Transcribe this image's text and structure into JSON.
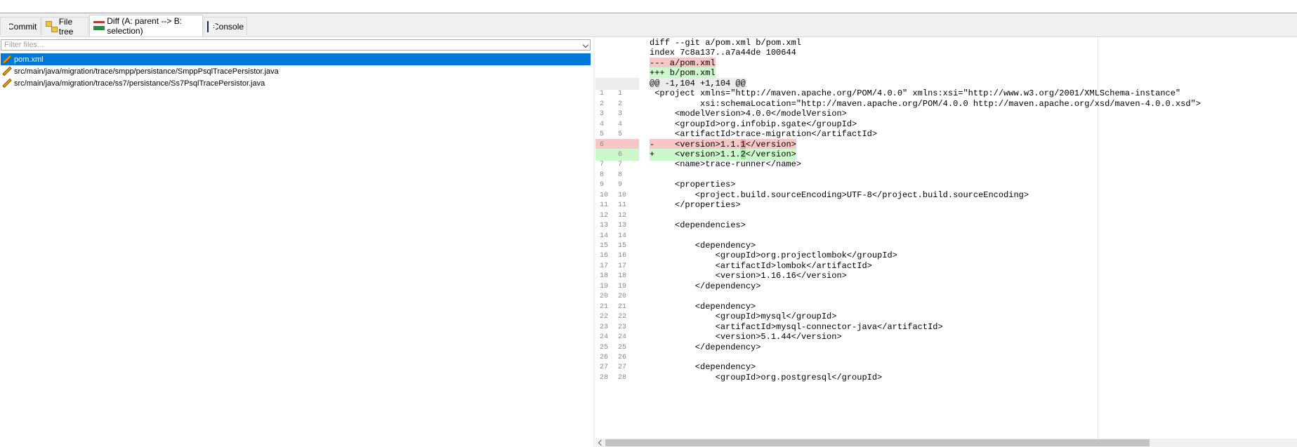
{
  "tabs": [
    {
      "label": "Commit",
      "icon": "info-icon"
    },
    {
      "label": "File tree",
      "icon": "file-tree-icon"
    },
    {
      "label": "Diff (A: parent --> B: selection)",
      "icon": "diff-icon"
    },
    {
      "label": "Console",
      "icon": "console-icon"
    }
  ],
  "filter": {
    "placeholder": "Filter files..."
  },
  "files": [
    {
      "name": "pom.xml",
      "status_icon": "modified-pencil-icon",
      "selected": true
    },
    {
      "name": "src/main/java/migration/trace/smpp/persistance/SmppPsqlTracePersistor.java",
      "status_icon": "modified-pencil-icon",
      "selected": false
    },
    {
      "name": "src/main/java/migration/trace/ss7/persistance/Ss7PsqlTracePersistor.java",
      "status_icon": "modified-pencil-icon",
      "selected": false
    }
  ],
  "diff": {
    "header": [
      {
        "text": "diff --git a/pom.xml b/pom.xml",
        "kind": "plain"
      },
      {
        "text": "index 7c8a137..a7a44de 100644",
        "kind": "plain"
      },
      {
        "text": "--- a/pom.xml",
        "kind": "del"
      },
      {
        "text": "+++ b/pom.xml",
        "kind": "add"
      },
      {
        "text": "@@ -1,104 +1,104 @@",
        "kind": "hunk"
      }
    ],
    "lines": [
      {
        "a": "1",
        "b": "1",
        "kind": "ctx",
        "text": " <project xmlns=\"http://maven.apache.org/POM/4.0.0\" xmlns:xsi=\"http://www.w3.org/2001/XMLSchema-instance\""
      },
      {
        "a": "2",
        "b": "2",
        "kind": "ctx",
        "text": "          xsi:schemaLocation=\"http://maven.apache.org/POM/4.0.0 http://maven.apache.org/xsd/maven-4.0.0.xsd\">"
      },
      {
        "a": "3",
        "b": "3",
        "kind": "ctx",
        "text": "     <modelVersion>4.0.0</modelVersion>"
      },
      {
        "a": "4",
        "b": "4",
        "kind": "ctx",
        "text": "     <groupId>org.infobip.sgate</groupId>"
      },
      {
        "a": "5",
        "b": "5",
        "kind": "ctx",
        "text": "     <artifactId>trace-migration</artifactId>"
      },
      {
        "a": "6",
        "b": "",
        "kind": "del",
        "text": "-    <version>1.1.1</version>",
        "pre": "-    <version>1.1.",
        "mark": "1",
        "post": "</version>"
      },
      {
        "a": "",
        "b": "6",
        "kind": "add",
        "text": "+    <version>1.1.2</version>",
        "pre": "+    <version>1.1.",
        "mark": "2",
        "post": "</version>"
      },
      {
        "a": "7",
        "b": "7",
        "kind": "ctx",
        "text": "     <name>trace-runner</name>"
      },
      {
        "a": "8",
        "b": "8",
        "kind": "ctx",
        "text": ""
      },
      {
        "a": "9",
        "b": "9",
        "kind": "ctx",
        "text": "     <properties>"
      },
      {
        "a": "10",
        "b": "10",
        "kind": "ctx",
        "text": "         <project.build.sourceEncoding>UTF-8</project.build.sourceEncoding>"
      },
      {
        "a": "11",
        "b": "11",
        "kind": "ctx",
        "text": "     </properties>"
      },
      {
        "a": "12",
        "b": "12",
        "kind": "ctx",
        "text": ""
      },
      {
        "a": "13",
        "b": "13",
        "kind": "ctx",
        "text": "     <dependencies>"
      },
      {
        "a": "14",
        "b": "14",
        "kind": "ctx",
        "text": ""
      },
      {
        "a": "15",
        "b": "15",
        "kind": "ctx",
        "text": "         <dependency>"
      },
      {
        "a": "16",
        "b": "16",
        "kind": "ctx",
        "text": "             <groupId>org.projectlombok</groupId>"
      },
      {
        "a": "17",
        "b": "17",
        "kind": "ctx",
        "text": "             <artifactId>lombok</artifactId>"
      },
      {
        "a": "18",
        "b": "18",
        "kind": "ctx",
        "text": "             <version>1.16.16</version>"
      },
      {
        "a": "19",
        "b": "19",
        "kind": "ctx",
        "text": "         </dependency>"
      },
      {
        "a": "20",
        "b": "20",
        "kind": "ctx",
        "text": ""
      },
      {
        "a": "21",
        "b": "21",
        "kind": "ctx",
        "text": "         <dependency>"
      },
      {
        "a": "22",
        "b": "22",
        "kind": "ctx",
        "text": "             <groupId>mysql</groupId>"
      },
      {
        "a": "23",
        "b": "23",
        "kind": "ctx",
        "text": "             <artifactId>mysql-connector-java</artifactId>"
      },
      {
        "a": "24",
        "b": "24",
        "kind": "ctx",
        "text": "             <version>5.1.44</version>"
      },
      {
        "a": "25",
        "b": "25",
        "kind": "ctx",
        "text": "         </dependency>"
      },
      {
        "a": "26",
        "b": "26",
        "kind": "ctx",
        "text": ""
      },
      {
        "a": "27",
        "b": "27",
        "kind": "ctx",
        "text": "         <dependency>"
      },
      {
        "a": "28",
        "b": "28",
        "kind": "ctx",
        "text": "             <groupId>org.postgresql</groupId>"
      }
    ]
  },
  "colors": {
    "selection": "#0078d7",
    "deleted": "#f7c7c7",
    "added": "#cdf7cd",
    "hunk": "#ececec"
  }
}
